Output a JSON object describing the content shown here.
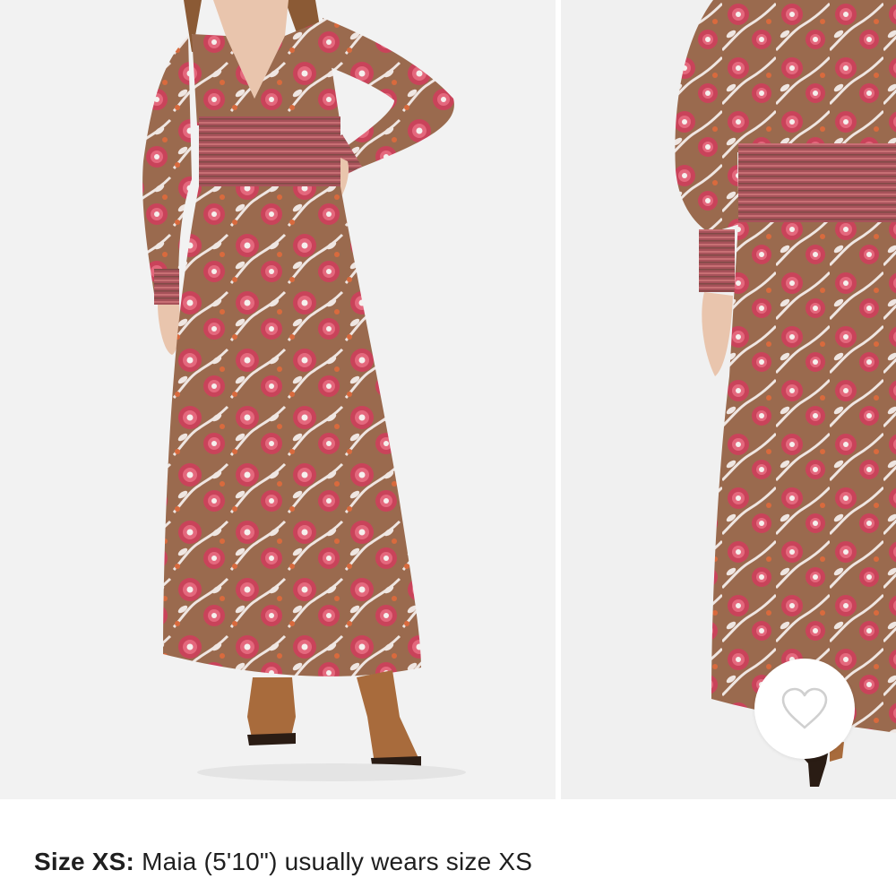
{
  "gallery": {
    "images": [
      {
        "name": "front view of maxi dress on model"
      },
      {
        "name": "side view of maxi dress on model"
      }
    ]
  },
  "favorite": {
    "icon": "heart-outline-icon"
  },
  "size_note": {
    "label": "Size XS:",
    "text": " Maia (5'10\") usually wears size XS"
  },
  "colors": {
    "fabric_base": "#9a6a4e",
    "flower_red": "#c9435a",
    "leaf_white": "#f3ece8",
    "boot": "#a86b3c"
  }
}
